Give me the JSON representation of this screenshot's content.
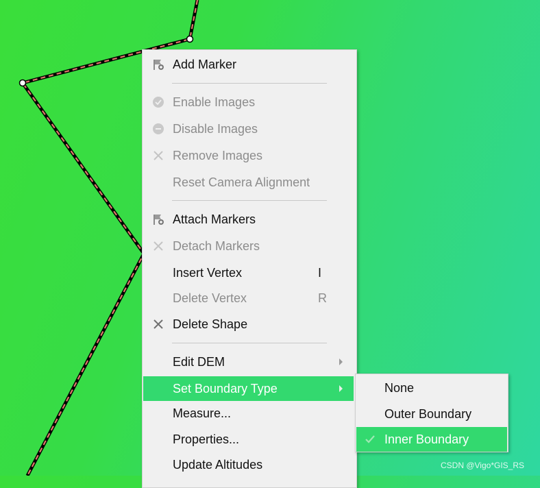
{
  "context_menu": {
    "items": [
      {
        "label": "Add Marker",
        "icon": "flag-plus-icon",
        "enabled": true
      },
      {
        "label": "Enable Images",
        "icon": "check-circle-icon",
        "enabled": false
      },
      {
        "label": "Disable Images",
        "icon": "minus-circle-icon",
        "enabled": false
      },
      {
        "label": "Remove Images",
        "icon": "x-icon",
        "enabled": false
      },
      {
        "label": "Reset Camera Alignment",
        "icon": "",
        "enabled": false
      },
      {
        "label": "Attach Markers",
        "icon": "flag-plus-icon",
        "enabled": true
      },
      {
        "label": "Detach Markers",
        "icon": "x-icon",
        "enabled": false
      },
      {
        "label": "Insert Vertex",
        "shortcut": "I",
        "enabled": true
      },
      {
        "label": "Delete Vertex",
        "shortcut": "R",
        "enabled": false
      },
      {
        "label": "Delete Shape",
        "icon": "x-icon",
        "enabled": true
      },
      {
        "label": "Edit DEM",
        "has_submenu": true,
        "enabled": true
      },
      {
        "label": "Set Boundary Type",
        "has_submenu": true,
        "enabled": true,
        "highlighted": true
      },
      {
        "label": "Measure...",
        "enabled": true
      },
      {
        "label": "Properties...",
        "enabled": true
      },
      {
        "label": "Update Altitudes",
        "enabled": true
      }
    ]
  },
  "submenu": {
    "items": [
      {
        "label": "None",
        "checked": false
      },
      {
        "label": "Outer Boundary",
        "checked": false
      },
      {
        "label": "Inner Boundary",
        "checked": true,
        "highlighted": true
      }
    ]
  },
  "watermark": "CSDN @Vigo*GIS_RS",
  "colors": {
    "highlight": "#33d96f",
    "menu_bg": "#f0f0f0",
    "disabled_text": "#8c8c8c",
    "shape_line": "#000000",
    "shape_dash": "#e07a6a"
  }
}
